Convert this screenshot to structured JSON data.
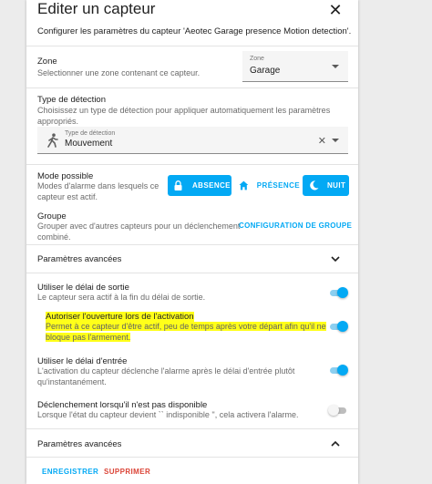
{
  "dialog": {
    "title": "Editer un capteur",
    "subtitle": "Configurer les paramètres du capteur 'Aeotec Garage presence Motion detection'."
  },
  "zone": {
    "title": "Zone",
    "description": "Selectionner une zone contenant ce capteur.",
    "field_label": "Zone",
    "value": "Garage"
  },
  "detection": {
    "title": "Type de détection",
    "description_lines": [
      "Choisissez un type de détection pour appliquer automatiquement les paramètres",
      "appropriés."
    ],
    "field_label": "Type de détection",
    "value": "Mouvement",
    "icon": "walking-person-icon"
  },
  "modes": {
    "title": "Mode possible",
    "description_lines": [
      "Modes d'alarme dans lesquels ce",
      "capteur est actif."
    ],
    "buttons": [
      {
        "label": "ABSENCE",
        "icon": "lock-icon",
        "selected": true
      },
      {
        "label": "PRÉSENCE",
        "icon": "home-icon",
        "selected": false
      },
      {
        "label": "NUIT",
        "icon": "moon-icon",
        "selected": true
      }
    ]
  },
  "group": {
    "title": "Groupe",
    "description_lines": [
      "Grouper avec d'autres capteurs pour un déclenchement",
      "combiné."
    ],
    "link": "CONFIGURATION DE GROUPE"
  },
  "advanced_collapsed": {
    "label": "Paramètres avancées",
    "icon": "chevron-down-icon"
  },
  "settings": [
    {
      "title": "Utiliser le délai de sortie",
      "description_lines": [
        "Le capteur sera actif à la fin du délai de sortie."
      ],
      "enabled": true,
      "highlighted": false
    },
    {
      "title": "Autoriser l'ouverture lors de l'activation",
      "description_lines": [
        "Permet à ce capteur d'être actif, peu de temps après votre départ afin qu'il ne",
        "bloque pas l'armement."
      ],
      "enabled": true,
      "highlighted": true
    },
    {
      "title": "Utiliser le délai d'entrée",
      "description_lines": [
        "L'activation du capteur déclenche l'alarme après le délai d'entrée plutôt",
        "qu'instantanément."
      ],
      "enabled": true,
      "highlighted": false
    },
    {
      "title": "Déclenchement lorsqu'il n'est pas disponible",
      "description_lines": [
        "Lorsque l'état du capteur devient `` indisponible '', cela activera l'alarme."
      ],
      "enabled": false,
      "highlighted": false
    }
  ],
  "advanced_expanded": {
    "label": "Paramètres avancées",
    "icon": "chevron-up-icon"
  },
  "footer": {
    "save": "ENREGISTRER",
    "delete": "SUPPRIMER"
  },
  "colors": {
    "accent": "#03a9f4",
    "danger": "#db4437",
    "highlight": "#ffff19"
  }
}
